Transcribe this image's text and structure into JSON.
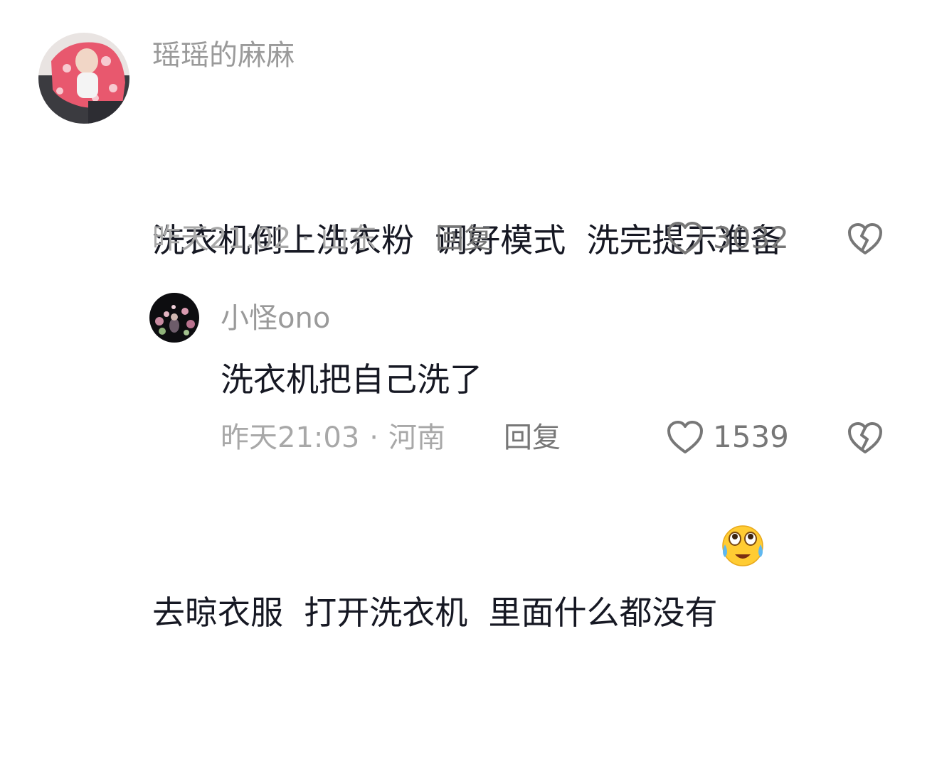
{
  "comments": [
    {
      "username": "瑶瑶的麻麻",
      "text_line1": "洗衣机倒上洗衣粉  调好模式  洗完提示准备",
      "text_line2": "去晾衣服  打开洗衣机  里面什么都没有",
      "emoji": "crying-laughing-emoji",
      "time": "昨天21:02",
      "separator": "·",
      "location": "山东",
      "reply_label": "回复",
      "like_count": "3032"
    },
    {
      "username": "小怪ono",
      "text": "洗衣机把自己洗了",
      "time": "昨天21:03",
      "separator": "·",
      "location": "河南",
      "reply_label": "回复",
      "like_count": "1539"
    }
  ],
  "colors": {
    "username": "#9a9a9a",
    "content": "#161823",
    "meta": "#a8a8a8",
    "action": "#777777"
  },
  "icons": [
    "heart-outline-icon",
    "broken-heart-icon"
  ]
}
